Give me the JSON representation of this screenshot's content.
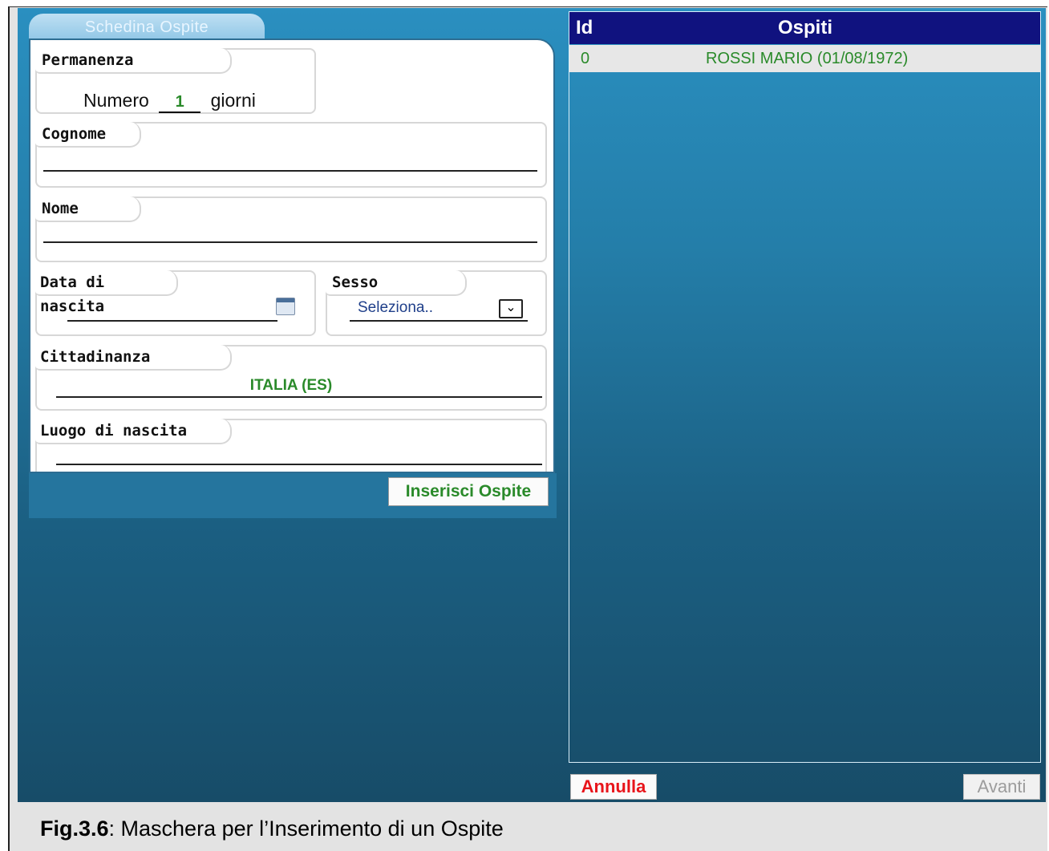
{
  "tab": {
    "label": "Schedina Ospite"
  },
  "form": {
    "permanenza": {
      "legend": "Permanenza",
      "prefix": "Numero",
      "value": "1",
      "suffix": "giorni"
    },
    "cognome": {
      "legend": "Cognome",
      "value": ""
    },
    "nome": {
      "legend": "Nome",
      "value": ""
    },
    "data_nascita": {
      "legend": "Data di nascita",
      "value": ""
    },
    "sesso": {
      "legend": "Sesso",
      "selected": "Seleziona.."
    },
    "cittadinanza": {
      "legend": "Cittadinanza",
      "value": "ITALIA (ES)"
    },
    "luogo_nascita": {
      "legend": "Luogo di nascita",
      "value": ""
    },
    "insert_label": "Inserisci Ospite"
  },
  "guests": {
    "columns": [
      "Id",
      "Ospiti"
    ],
    "rows": [
      {
        "id": "0",
        "name": "ROSSI MARIO (01/08/1972)"
      }
    ]
  },
  "buttons": {
    "annulla": "Annulla",
    "avanti": "Avanti"
  },
  "caption": {
    "label": "Fig.3.6",
    "text": ": Maschera per l’Inserimento di un Ospite"
  },
  "colors": {
    "header": "#10127f",
    "accent_green": "#2a8a2a",
    "cancel_red": "#e8141a"
  }
}
